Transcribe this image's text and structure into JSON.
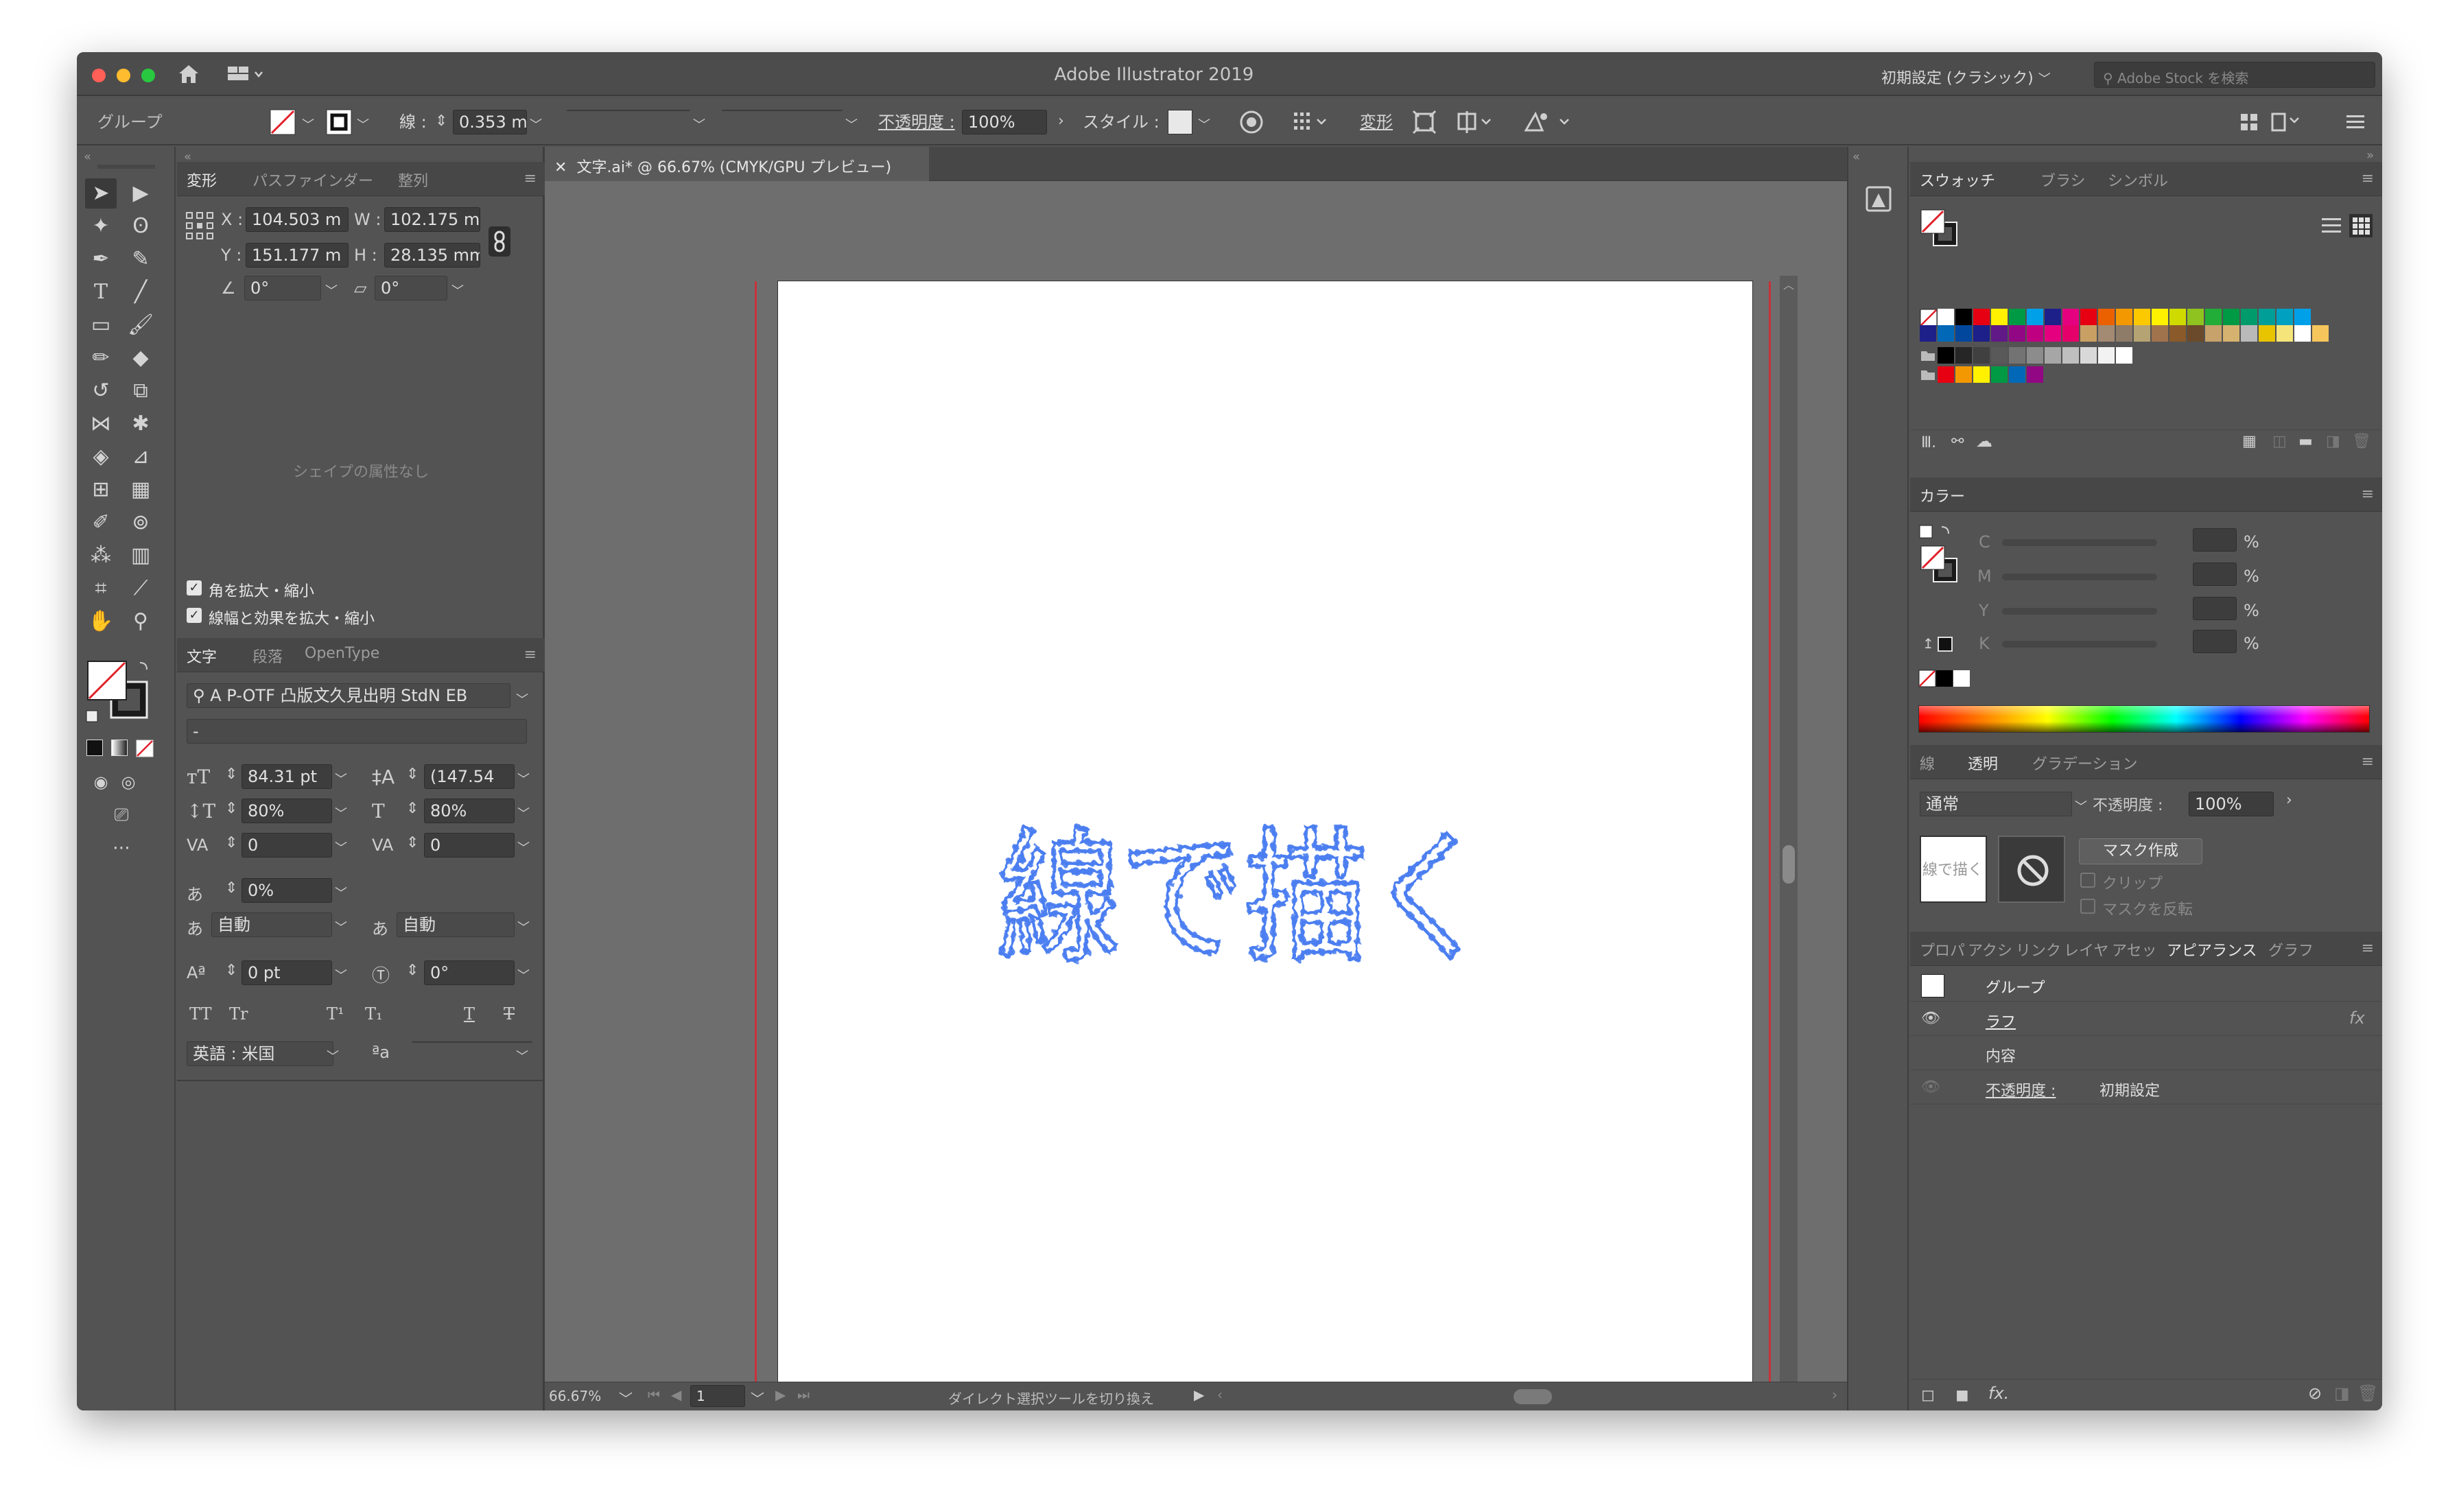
{
  "app": {
    "title": "Adobe Illustrator 2019",
    "workspace": "初期設定 (クラシック)",
    "stock_search_placeholder": "Adobe Stock を検索"
  },
  "control_bar": {
    "selection_type": "グループ",
    "stroke_label": "線 :",
    "stroke_weight": "0.353 m",
    "stroke_profile": "均等",
    "brush_label": "基本",
    "opacity_label": "不透明度 :",
    "opacity_value": "100%",
    "style_label": "スタイル :",
    "transform_label": "変形"
  },
  "transform_panel": {
    "tabs": [
      "変形",
      "パスファインダー",
      "整列"
    ],
    "x_label": "X :",
    "x_value": "104.503 m",
    "w_label": "W :",
    "w_value": "102.175 m",
    "y_label": "Y :",
    "y_value": "151.177 m",
    "h_label": "H :",
    "h_value": "28.135 mm",
    "angle_value": "0°",
    "shear_value": "0°",
    "shape_props_note": "シェイプの属性なし",
    "scale_corners_label": "角を拡大・縮小",
    "scale_strokes_label": "線幅と効果を拡大・縮小"
  },
  "character_panel": {
    "tabs": [
      "文字",
      "段落",
      "OpenType"
    ],
    "font_family": "A P-OTF 凸版文久見出明 StdN EB",
    "font_style": "-",
    "font_size": "84.31 pt",
    "leading": "(147.54",
    "vertical_scale": "80%",
    "horizontal_scale": "80%",
    "kerning": "0",
    "tracking": "0",
    "tsume": "0%",
    "aki_left": "自動",
    "aki_right": "自動",
    "baseline_shift": "0 pt",
    "rotation": "0°",
    "style_buttons": [
      "TT",
      "Tr",
      "T¹",
      "T₁",
      "T",
      "T"
    ],
    "language": "英語 : 米国",
    "aa_label": "ªa"
  },
  "document": {
    "tab_title": "文字.ai* @ 66.67% (CMYK/GPU プレビュー)",
    "artwork_text": "線で描く",
    "zoom": "66.67%",
    "artboard_number": "1",
    "status_message": "ダイレクト選択ツールを切り換え"
  },
  "swatches_panel": {
    "tabs": [
      "スウォッチ",
      "ブラシ",
      "シンボル"
    ],
    "row1": [
      "#ffffff",
      "#000000",
      "#e60012",
      "#fff100",
      "#009944",
      "#00a0e9",
      "#1d2088",
      "#e4007f",
      "#e60012",
      "#eb6100",
      "#f39800",
      "#fcc800",
      "#fff100",
      "#cfdb00",
      "#8fc31f",
      "#22ac38",
      "#009944",
      "#009b6b",
      "#009e96",
      "#00a0c1",
      "#00a0e9"
    ],
    "row2": [
      "#0068b7",
      "#00479d",
      "#1d2088",
      "#601986",
      "#920783",
      "#be0081",
      "#e4007f",
      "#e5006a",
      "#c9a063",
      "#a38a72",
      "#8e7b68",
      "#b6a373",
      "#a0734d",
      "#8a5a2b",
      "#6b4a2b",
      "#c7a26b",
      "#d5b26f",
      "#b9b9b9",
      "#e8c300",
      "#f5e47a",
      "#ffffff",
      "#f6c55b"
    ],
    "row3": [
      "#000000",
      "#262626",
      "#404040",
      "#595959",
      "#737373",
      "#8c8c8c",
      "#a6a6a6",
      "#bfbfbf",
      "#d9d9d9",
      "#f2f2f2",
      "#ffffff"
    ],
    "row4": [
      "#e60012",
      "#f39800",
      "#fff100",
      "#009944",
      "#0068b7",
      "#920783"
    ]
  },
  "color_panel": {
    "title": "カラー",
    "channels": [
      {
        "label": "C",
        "unit": "%"
      },
      {
        "label": "M",
        "unit": "%"
      },
      {
        "label": "Y",
        "unit": "%"
      },
      {
        "label": "K",
        "unit": "%"
      }
    ]
  },
  "transparency_panel": {
    "tabs": [
      "線",
      "透明",
      "グラデーション"
    ],
    "blend_mode": "通常",
    "opacity_label": "不透明度 :",
    "opacity_value": "100%",
    "thumbnail_text": "線で描く",
    "make_mask_label": "マスク作成",
    "clip_label": "クリップ",
    "invert_label": "マスクを反転"
  },
  "appearance_panel": {
    "tabs": [
      "プロパ",
      "アクシ",
      "リンク",
      "レイヤ",
      "アセッ",
      "アピアランス",
      "グラフ"
    ],
    "group_label": "グループ",
    "rough_label": "ラフ",
    "contents_label": "内容",
    "opacity_label": "不透明度 :",
    "opacity_value": "初期設定",
    "fx_label": "fx"
  }
}
